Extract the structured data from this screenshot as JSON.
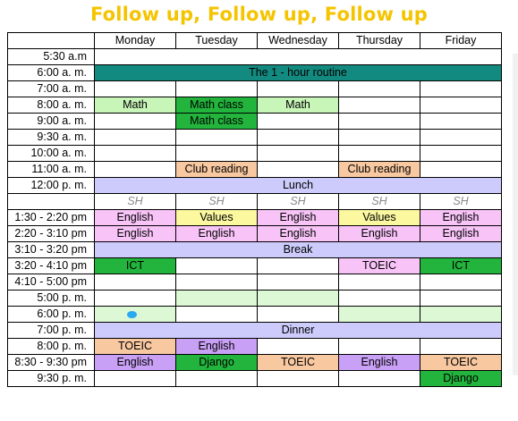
{
  "title": "Follow up, Follow up, Follow up",
  "days": [
    "Monday",
    "Tuesday",
    "Wednesday",
    "Thursday",
    "Friday"
  ],
  "colors": {
    "teal": "#138a80",
    "light_green": "#c8f5b8",
    "green": "#22b43c",
    "orange": "#f8c8a0",
    "lavender": "#cccbfb",
    "pink": "#f8c4f8",
    "yellow": "#fbf8a0",
    "purple": "#c8a0f5",
    "pale_green": "#dcf8d4",
    "white": "#ffffff"
  },
  "rows": [
    {
      "time": "5:30 a.m",
      "cells": [
        {
          "text": "",
          "span": 5
        }
      ]
    },
    {
      "time": "6:00 a. m.",
      "cells": [
        {
          "text": "The 1 - hour routine",
          "span": 5,
          "color": "teal"
        }
      ]
    },
    {
      "time": "7:00 a. m.",
      "cells": [
        {
          "text": ""
        },
        {
          "text": ""
        },
        {
          "text": ""
        },
        {
          "text": ""
        },
        {
          "text": ""
        }
      ]
    },
    {
      "time": "8:00 a. m.",
      "cells": [
        {
          "text": "Math",
          "color": "light_green"
        },
        {
          "text": "Math class",
          "color": "green"
        },
        {
          "text": "Math",
          "color": "light_green"
        },
        {
          "text": ""
        },
        {
          "text": ""
        }
      ]
    },
    {
      "time": "9:00 a. m.",
      "cells": [
        {
          "text": ""
        },
        {
          "text": "Math class",
          "color": "green"
        },
        {
          "text": ""
        },
        {
          "text": ""
        },
        {
          "text": ""
        }
      ]
    },
    {
      "time": "9:30 a. m.",
      "cells": [
        {
          "text": ""
        },
        {
          "text": ""
        },
        {
          "text": ""
        },
        {
          "text": ""
        },
        {
          "text": ""
        }
      ]
    },
    {
      "time": "10:00 a. m.",
      "cells": [
        {
          "text": ""
        },
        {
          "text": ""
        },
        {
          "text": ""
        },
        {
          "text": ""
        },
        {
          "text": ""
        }
      ]
    },
    {
      "time": "11:00 a. m.",
      "cells": [
        {
          "text": ""
        },
        {
          "text": "Club reading",
          "color": "orange"
        },
        {
          "text": ""
        },
        {
          "text": "Club reading",
          "color": "orange"
        },
        {
          "text": ""
        }
      ]
    },
    {
      "time": "12:00 p. m.",
      "cells": [
        {
          "text": "Lunch",
          "span": 5,
          "color": "lavender"
        }
      ]
    },
    {
      "time": "",
      "sh": true,
      "cells": [
        {
          "text": "SH"
        },
        {
          "text": "SH"
        },
        {
          "text": "SH"
        },
        {
          "text": "SH"
        },
        {
          "text": "SH"
        }
      ]
    },
    {
      "time": "1:30 - 2:20 pm",
      "cells": [
        {
          "text": "English",
          "color": "pink"
        },
        {
          "text": "Values",
          "color": "yellow"
        },
        {
          "text": "English",
          "color": "pink"
        },
        {
          "text": "Values",
          "color": "yellow"
        },
        {
          "text": "English",
          "color": "pink"
        }
      ]
    },
    {
      "time": "2:20 - 3:10 pm",
      "cells": [
        {
          "text": "English",
          "color": "pink"
        },
        {
          "text": "English",
          "color": "pink"
        },
        {
          "text": "English",
          "color": "pink"
        },
        {
          "text": "English",
          "color": "pink"
        },
        {
          "text": "English",
          "color": "pink"
        }
      ]
    },
    {
      "time": "3:10 - 3:20 pm",
      "cells": [
        {
          "text": "Break",
          "span": 5,
          "color": "lavender"
        }
      ]
    },
    {
      "time": "3:20 - 4:10 pm",
      "cells": [
        {
          "text": "ICT",
          "color": "green"
        },
        {
          "text": ""
        },
        {
          "text": ""
        },
        {
          "text": "TOEIC",
          "color": "pink"
        },
        {
          "text": "ICT",
          "color": "green"
        }
      ]
    },
    {
      "time": "4:10 - 5:00 pm",
      "cells": [
        {
          "text": ""
        },
        {
          "text": ""
        },
        {
          "text": ""
        },
        {
          "text": ""
        },
        {
          "text": ""
        }
      ]
    },
    {
      "time": "5:00 p. m.",
      "cells": [
        {
          "text": ""
        },
        {
          "text": "",
          "color": "pale_green"
        },
        {
          "text": "",
          "color": "pale_green"
        },
        {
          "text": ""
        },
        {
          "text": ""
        }
      ]
    },
    {
      "time": "6:00 p. m.",
      "cells": [
        {
          "text": "",
          "color": "pale_green",
          "dot": true
        },
        {
          "text": ""
        },
        {
          "text": ""
        },
        {
          "text": "",
          "color": "pale_green"
        },
        {
          "text": "",
          "color": "pale_green"
        }
      ]
    },
    {
      "time": "7:00 p. m.",
      "cells": [
        {
          "text": "Dinner",
          "span": 5,
          "color": "lavender"
        }
      ]
    },
    {
      "time": "8:00 p. m.",
      "cells": [
        {
          "text": "TOEIC",
          "color": "orange"
        },
        {
          "text": "English",
          "color": "purple"
        },
        {
          "text": ""
        },
        {
          "text": ""
        },
        {
          "text": ""
        }
      ]
    },
    {
      "time": "8:30 - 9:30 pm",
      "cells": [
        {
          "text": "English",
          "color": "purple"
        },
        {
          "text": "Django",
          "color": "green"
        },
        {
          "text": "TOEIC",
          "color": "orange"
        },
        {
          "text": "English",
          "color": "purple"
        },
        {
          "text": "TOEIC",
          "color": "orange"
        }
      ]
    },
    {
      "time": "9:30 p. m.",
      "cells": [
        {
          "text": ""
        },
        {
          "text": ""
        },
        {
          "text": ""
        },
        {
          "text": ""
        },
        {
          "text": "Django",
          "color": "green"
        }
      ]
    }
  ]
}
